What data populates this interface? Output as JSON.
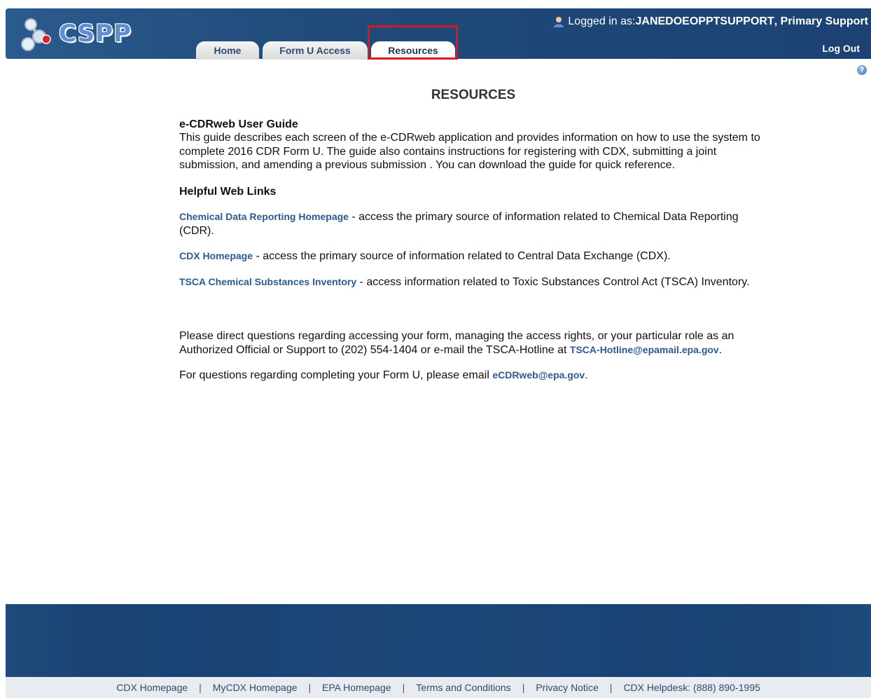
{
  "header": {
    "logo_text": "CSPP",
    "login_prefix": "Logged in as: ",
    "username": "JANEDOEOPPTSUPPORT",
    "role": ", Primary Support",
    "logout": "Log Out",
    "tabs": [
      {
        "label": "Home",
        "active": false
      },
      {
        "label": "Form U Access",
        "active": false
      },
      {
        "label": "Resources",
        "active": true
      }
    ]
  },
  "main": {
    "title": "RESOURCES",
    "guide": {
      "heading": "e-CDRweb User Guide",
      "description": "This guide describes each screen of the e-CDRweb application and provides information on how to use the system to complete 2016 CDR Form U. The guide also contains instructions for registering with CDX, submitting a joint submission, and amending a previous submission . You can download the guide for quick reference."
    },
    "links_heading": "Helpful Web Links",
    "links": [
      {
        "label": "Chemical Data Reporting Homepage",
        "text": " - access the primary source of information related to Chemical Data Reporting (CDR)."
      },
      {
        "label": "CDX Homepage",
        "text": " - access the primary source of information related to Central Data Exchange (CDX)."
      },
      {
        "label": "TSCA Chemical Substances Inventory",
        "text": " - access information related to Toxic Substances Control Act (TSCA) Inventory."
      }
    ],
    "contact": {
      "text": "Please direct questions regarding accessing your form, managing the access rights, or your particular role as an Authorized Official or Support to (202) 554-1404 or e-mail the TSCA-Hotline at ",
      "email": "TSCA-Hotline@epamail.epa.gov",
      "end": "."
    },
    "form_questions": {
      "text": "For questions regarding completing your Form U, please email ",
      "email": "eCDRweb@epa.gov",
      "end": "."
    }
  },
  "footer": {
    "links": [
      "CDX Homepage",
      "MyCDX Homepage",
      "EPA Homepage",
      "Terms and Conditions",
      "Privacy Notice"
    ],
    "helpdesk": "CDX Helpdesk: (888) 890-1995",
    "separator": "|"
  },
  "colors": {
    "header_blue": "#1f4a7a",
    "link_blue": "#2d5a90",
    "highlight_red": "#e0141e"
  }
}
